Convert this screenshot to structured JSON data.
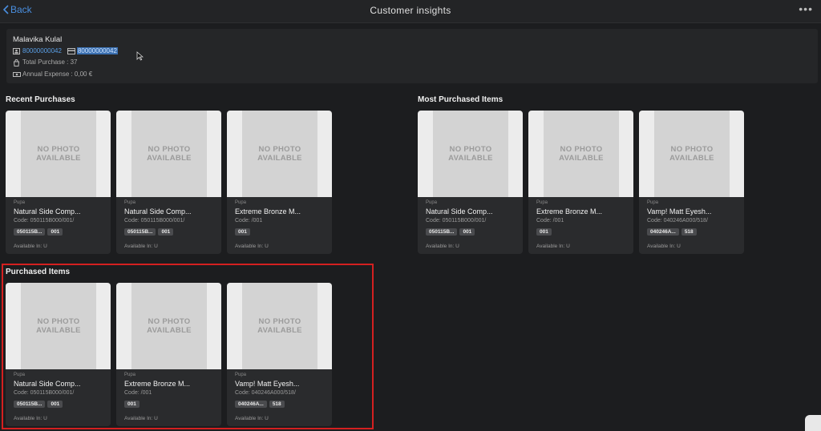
{
  "header": {
    "back_label": "Back",
    "title": "Customer insights",
    "more_label": "•••"
  },
  "customer": {
    "name": "Malavika Kulal",
    "id": "80000000042",
    "phone": "80000000042",
    "total_purchase": "Total Purchase : 37",
    "annual_expense": "Annual Expense : 0,00 €"
  },
  "sections": {
    "recent": {
      "title": "Recent Purchases",
      "items": [
        {
          "photo": "NO PHOTO\nAVAILABLE",
          "brand": "Pupa",
          "name": "Natural Side Comp...",
          "code": "Code: 050115B000/001/",
          "badges": [
            "050115B...",
            "001"
          ],
          "avail": "Available In: U"
        },
        {
          "photo": "NO PHOTO\nAVAILABLE",
          "brand": "Pupa",
          "name": "Natural Side Comp...",
          "code": "Code: 050115B000/001/",
          "badges": [
            "050115B...",
            "001"
          ],
          "avail": "Available In: U"
        },
        {
          "photo": "NO PHOTO\nAVAILABLE",
          "brand": "Pupa",
          "name": "Extreme Bronze M...",
          "code": "Code: /001",
          "badges": [
            "001"
          ],
          "avail": "Available In: U"
        }
      ]
    },
    "most": {
      "title": "Most Purchased Items",
      "items": [
        {
          "photo": "NO PHOTO\nAVAILABLE",
          "brand": "Pupa",
          "name": "Natural Side Comp...",
          "code": "Code: 050115B000/001/",
          "badges": [
            "050115B...",
            "001"
          ],
          "avail": "Available In: U"
        },
        {
          "photo": "NO PHOTO\nAVAILABLE",
          "brand": "Pupa",
          "name": "Extreme Bronze M...",
          "code": "Code: /001",
          "badges": [
            "001"
          ],
          "avail": "Available In: U"
        },
        {
          "photo": "NO PHOTO\nAVAILABLE",
          "brand": "Pupa",
          "name": "Vamp! Matt Eyesh...",
          "code": "Code: 040246A000/518/",
          "badges": [
            "040246A...",
            "518"
          ],
          "avail": "Available In: U"
        }
      ]
    },
    "purchased": {
      "title": "Purchased Items",
      "items": [
        {
          "photo": "NO PHOTO\nAVAILABLE",
          "brand": "Pupa",
          "name": "Natural Side Comp...",
          "code": "Code: 050115B000/001/",
          "badges": [
            "050115B...",
            "001"
          ],
          "avail": "Available In: U"
        },
        {
          "photo": "NO PHOTO\nAVAILABLE",
          "brand": "Pupa",
          "name": "Extreme Bronze M...",
          "code": "Code: /001",
          "badges": [
            "001"
          ],
          "avail": "Available In: U"
        },
        {
          "photo": "NO PHOTO\nAVAILABLE",
          "brand": "Pupa",
          "name": "Vamp! Matt Eyesh...",
          "code": "Code: 040246A000/518/",
          "badges": [
            "040246A...",
            "518"
          ],
          "avail": "Available In: U"
        }
      ]
    }
  },
  "colors": {
    "accent": "#4a8fe0",
    "highlight": "#d42020",
    "background": "#1c1d1f"
  }
}
